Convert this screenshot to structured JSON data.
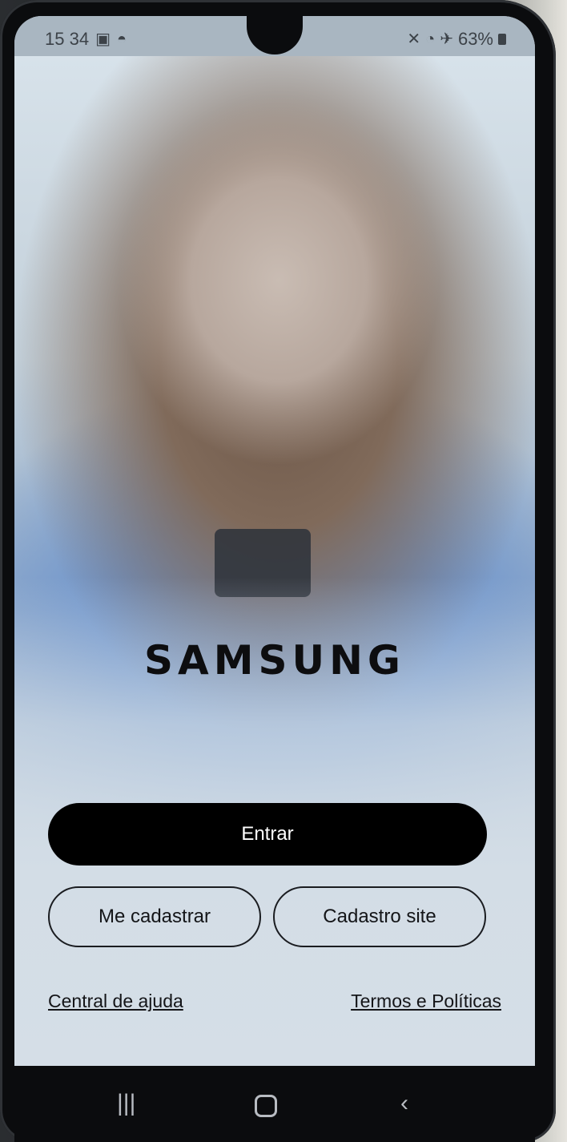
{
  "status_bar": {
    "time": "15 34",
    "battery": "63%"
  },
  "brand": {
    "logo_text": "SAMSUNG"
  },
  "actions": {
    "primary": "Entrar",
    "register": "Me cadastrar",
    "site_register": "Cadastro site"
  },
  "links": {
    "help": "Central de ajuda",
    "terms": "Termos e Políticas"
  },
  "nav": {
    "recent": "recent-apps-icon",
    "home": "home-icon",
    "back": "back-icon"
  },
  "colors": {
    "primary_button_bg": "#000000",
    "primary_button_text": "#ffffff"
  }
}
